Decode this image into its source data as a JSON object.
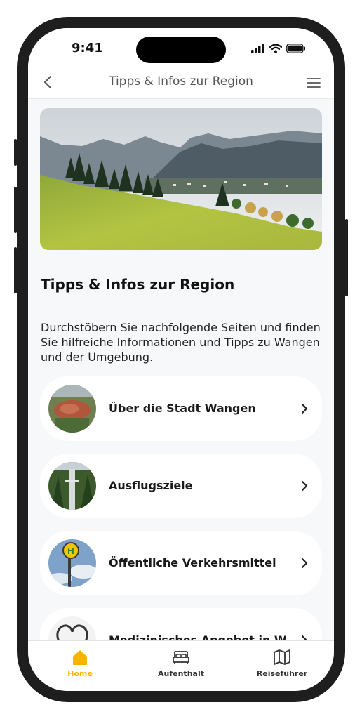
{
  "status_bar": {
    "time": "9:41"
  },
  "nav": {
    "title": "Tipps & Infos zur Region"
  },
  "page": {
    "heading": "Tipps & Infos zur Region",
    "intro": "Durchstöbern Sie nachfolgende Seiten und finden Sie hilfreiche Informationen und Tipps zu Wangen und der Umgebung."
  },
  "items": [
    {
      "label": "Über die Stadt Wangen"
    },
    {
      "label": "Ausflugsziele"
    },
    {
      "label": "Öffentliche Verkehrsmittel"
    },
    {
      "label": "Medizinisches Angebot in W"
    }
  ],
  "tabs": [
    {
      "label": "Home",
      "icon": "home-icon",
      "active": true
    },
    {
      "label": "Aufenthalt",
      "icon": "bed-icon",
      "active": false
    },
    {
      "label": "Reiseführer",
      "icon": "map-icon",
      "active": false
    }
  ],
  "colors": {
    "accent": "#f4b400",
    "background": "#f7f8f9",
    "card": "#ffffff"
  }
}
